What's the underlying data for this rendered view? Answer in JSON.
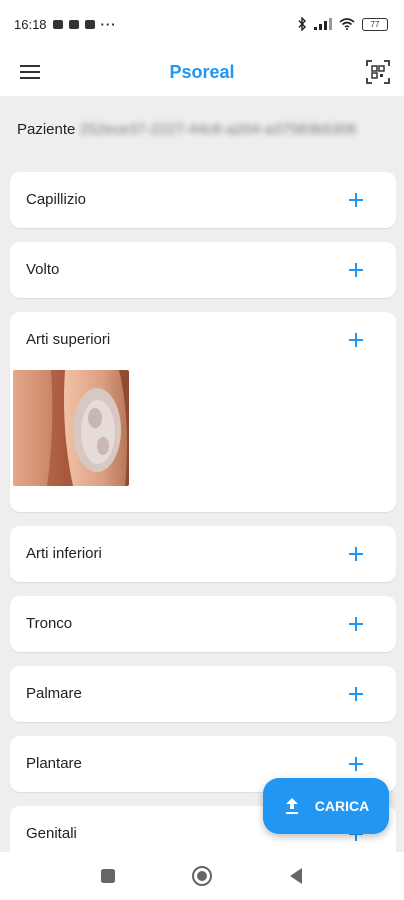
{
  "status_bar": {
    "time": "16:18",
    "battery_level": "77",
    "icons": [
      "notification-icon",
      "youtube-icon",
      "teams-icon",
      "more-icon",
      "bluetooth-icon",
      "signal-icon",
      "wifi-icon",
      "battery-icon"
    ],
    "more": "···"
  },
  "app_bar": {
    "title": "Psoreal",
    "left_icon": "menu-icon",
    "right_icon": "qr-scan-icon",
    "accent_color": "#2196f3"
  },
  "patient": {
    "label": "Paziente",
    "id": "252ece37-2227-44c6-a204-a37583b5306"
  },
  "body_areas": [
    {
      "label": "Capillizio",
      "has_image": false
    },
    {
      "label": "Volto",
      "has_image": false
    },
    {
      "label": "Arti superiori",
      "has_image": true
    },
    {
      "label": "Arti inferiori",
      "has_image": false
    },
    {
      "label": "Tronco",
      "has_image": false
    },
    {
      "label": "Palmare",
      "has_image": false
    },
    {
      "label": "Plantare",
      "has_image": false
    },
    {
      "label": "Genitali",
      "has_image": false
    }
  ],
  "fab": {
    "label": "CARICA",
    "icon": "upload-icon"
  },
  "nav_bar": {
    "icons": [
      "recents-icon",
      "home-icon",
      "back-icon"
    ]
  }
}
